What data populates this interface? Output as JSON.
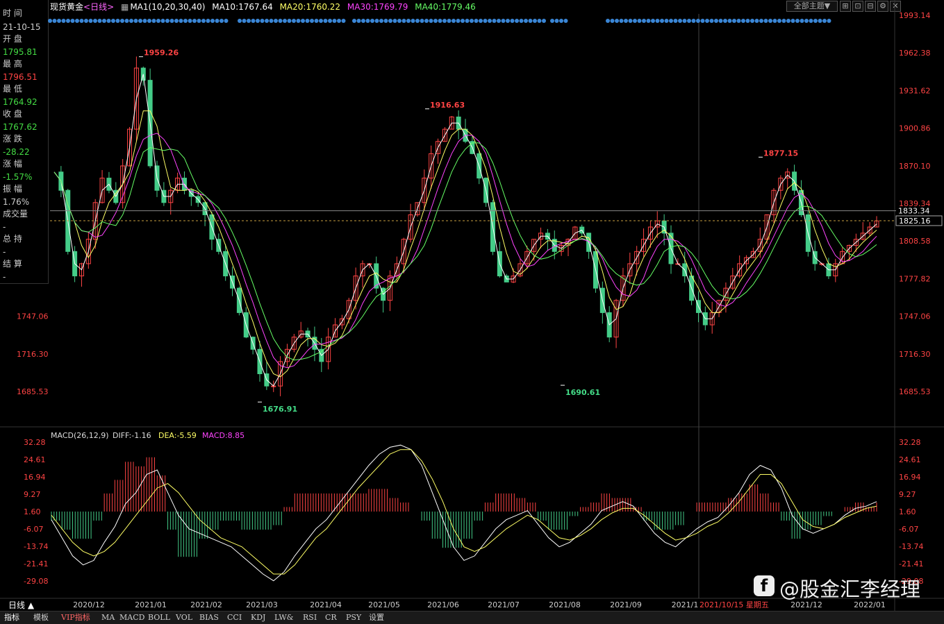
{
  "header": {
    "symbol": "现货黄金",
    "period": "<日线>",
    "ma_label": "MA1(10,20,30,40)",
    "ma10": "MA10:1767.64",
    "ma20": "MA20:1760.22",
    "ma30": "MA30:1769.79",
    "ma40": "MA40:1779.46",
    "theme_select": "全部主题▼",
    "colors": {
      "ma10": "#ffffff",
      "ma20": "#ffff66",
      "ma30": "#ff44ff",
      "ma40": "#66ff66",
      "up": "#ff4444",
      "down": "#44cc88",
      "axis_red": "#ff4444",
      "ohlc_green": "#44dd44"
    }
  },
  "info_panel": {
    "time_label": "时 间",
    "time_value": "21-10-15",
    "open_label": "开 盘",
    "open_value": "1795.81",
    "high_label": "最 高",
    "high_value": "1796.51",
    "low_label": "最 低",
    "low_value": "1764.92",
    "close_label": "收 盘",
    "close_value": "1767.62",
    "change_label": "涨 跌",
    "change_value": "-28.22",
    "pct_label": "涨 幅",
    "pct_value": "-1.57%",
    "amp_label": "振 幅",
    "amp_value": "1.76%",
    "vol_label": "成交量",
    "vol_value": "-",
    "hold_label": "总 持",
    "hold_value": "-",
    "settle_label": "结 算",
    "settle_value": "-"
  },
  "macd": {
    "label": "MACD(26,12,9)",
    "diff": "DIFF:-1.16",
    "dea": "DEA:-5.59",
    "macd": "MACD:8.85"
  },
  "bottom": {
    "period_button": "日线 ▲",
    "tabs": [
      "指标",
      "模板",
      "VIP指标",
      "MA",
      "MACD",
      "BOLL",
      "VOL",
      "BIAS",
      "CCI",
      "KDJ",
      "LW&",
      "RSI",
      "CR",
      "PSY",
      "设置"
    ]
  },
  "watermark": "@股金汇李经理",
  "crosshair_date_label": "2021/10/15 星期五",
  "chart_data": [
    {
      "type": "candlestick",
      "title": "现货黄金 日线",
      "y_ticks": [
        1993.14,
        1962.38,
        1931.62,
        1900.86,
        1870.1,
        1839.34,
        1808.58,
        1777.82,
        1747.06,
        1716.3,
        1685.53
      ],
      "y_ticks_labels": [
        "1993.14",
        "1962.38",
        "1931.62",
        "1900.86",
        "1870.10",
        "1839.34",
        "1808.58",
        "1777.82",
        "1747.06",
        "1716.30",
        "1685.53"
      ],
      "ylim": [
        1670,
        2000
      ],
      "x_ticks": [
        "2020/12",
        "2021/01",
        "2021/02",
        "2021/03",
        "2021/04",
        "2021/05",
        "2021/06",
        "2021/07",
        "2021/08",
        "2021/09",
        "2021/1",
        "2021/12",
        "2022/01"
      ],
      "crosshair_price": "1833.34",
      "last_price": "1825.16",
      "annotations": [
        {
          "label": "1959.26",
          "date": "2021/01",
          "value": 1959.26,
          "kind": "high"
        },
        {
          "label": "1676.91",
          "date": "2021/03",
          "value": 1676.91,
          "kind": "low"
        },
        {
          "label": "1916.63",
          "date": "2021/06",
          "value": 1916.63,
          "kind": "high"
        },
        {
          "label": "1690.61",
          "date": "2021/08",
          "value": 1690.61,
          "kind": "low"
        },
        {
          "label": "1877.15",
          "date": "2021/11",
          "value": 1877.15,
          "kind": "high"
        }
      ],
      "close_path": [
        1865,
        1850,
        1800,
        1780,
        1790,
        1810,
        1840,
        1860,
        1850,
        1840,
        1870,
        1900,
        1950,
        1940,
        1870,
        1850,
        1840,
        1850,
        1860,
        1850,
        1845,
        1840,
        1830,
        1810,
        1800,
        1780,
        1770,
        1750,
        1730,
        1720,
        1700,
        1690,
        1690,
        1710,
        1720,
        1730,
        1735,
        1730,
        1720,
        1710,
        1730,
        1740,
        1745,
        1760,
        1780,
        1790,
        1790,
        1770,
        1760,
        1780,
        1790,
        1810,
        1830,
        1840,
        1860,
        1880,
        1890,
        1900,
        1910,
        1900,
        1890,
        1880,
        1860,
        1840,
        1800,
        1780,
        1775,
        1780,
        1790,
        1800,
        1810,
        1815,
        1810,
        1800,
        1805,
        1810,
        1820,
        1815,
        1800,
        1770,
        1750,
        1730,
        1760,
        1780,
        1790,
        1800,
        1810,
        1820,
        1825,
        1815,
        1790,
        1790,
        1780,
        1760,
        1750,
        1740,
        1750,
        1760,
        1770,
        1780,
        1790,
        1795,
        1800,
        1810,
        1830,
        1850,
        1860,
        1865,
        1850,
        1830,
        1800,
        1790,
        1790,
        1780,
        1790,
        1800,
        1805,
        1810,
        1815,
        1820,
        1825
      ]
    },
    {
      "type": "line",
      "title": "MACD(26,12,9)",
      "series": [
        {
          "name": "DIFF",
          "values": [
            -2,
            -10,
            -18,
            -22,
            -20,
            -12,
            -5,
            5,
            10,
            18,
            20,
            10,
            0,
            -6,
            -8,
            -10,
            -12,
            -14,
            -18,
            -22,
            -26,
            -29,
            -25,
            -18,
            -12,
            -6,
            -2,
            4,
            10,
            16,
            22,
            27,
            30,
            31,
            29,
            22,
            10,
            -2,
            -14,
            -20,
            -18,
            -12,
            -6,
            -2,
            0,
            2,
            -4,
            -10,
            -14,
            -12,
            -8,
            -4,
            2,
            4,
            6,
            4,
            -2,
            -8,
            -12,
            -14,
            -10,
            -6,
            -3,
            -1,
            4,
            10,
            18,
            22,
            20,
            12,
            0,
            -6,
            -8,
            -6,
            -4,
            0,
            3,
            4,
            6
          ]
        },
        {
          "name": "DEA",
          "values": [
            0,
            -6,
            -12,
            -16,
            -18,
            -16,
            -12,
            -6,
            0,
            6,
            12,
            14,
            10,
            4,
            -2,
            -6,
            -10,
            -12,
            -14,
            -18,
            -22,
            -26,
            -26,
            -22,
            -16,
            -10,
            -6,
            0,
            6,
            12,
            17,
            22,
            27,
            29,
            29,
            24,
            16,
            6,
            -6,
            -14,
            -16,
            -14,
            -10,
            -6,
            -3,
            0,
            -2,
            -6,
            -10,
            -11,
            -9,
            -6,
            -2,
            1,
            3,
            3,
            0,
            -4,
            -8,
            -11,
            -10,
            -8,
            -5,
            -3,
            1,
            6,
            12,
            18,
            18,
            14,
            6,
            -2,
            -5,
            -6,
            -4,
            -1,
            1,
            3,
            4
          ]
        },
        {
          "name": "MACD",
          "values": [
            -4,
            -8,
            -12,
            -12,
            -4,
            8,
            14,
            22,
            20,
            24,
            16,
            -8,
            -20,
            -20,
            -12,
            -8,
            -4,
            -4,
            -8,
            -8,
            -8,
            -6,
            2,
            8,
            8,
            8,
            8,
            8,
            8,
            8,
            10,
            10,
            6,
            4,
            0,
            -4,
            -12,
            -16,
            -16,
            -12,
            -4,
            4,
            8,
            8,
            6,
            4,
            -4,
            -8,
            -8,
            -2,
            2,
            4,
            8,
            6,
            6,
            2,
            -4,
            -8,
            -8,
            -6,
            0,
            4,
            4,
            4,
            6,
            8,
            12,
            8,
            4,
            -4,
            -12,
            -8,
            -6,
            -2,
            0,
            2,
            4,
            2,
            4
          ]
        }
      ],
      "y_ticks_labels": [
        "32.28",
        "24.61",
        "16.94",
        "9.27",
        "1.60",
        "-6.07",
        "-13.74",
        "-21.41",
        "-29.08"
      ],
      "ylim": [
        -36,
        33
      ]
    }
  ]
}
